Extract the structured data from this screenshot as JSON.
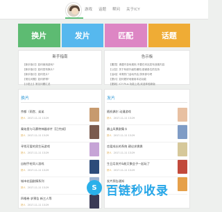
{
  "nav": {
    "items": [
      "游戏",
      "话题",
      "帮问",
      "关于ICY"
    ]
  },
  "tiles": [
    {
      "label": "换片",
      "color": "#5dbb72"
    },
    {
      "label": "发片",
      "color": "#56b8ee"
    },
    {
      "label": "匹配",
      "color": "#dd86c4"
    },
    {
      "label": "话题",
      "color": "#efac35"
    }
  ],
  "guide": {
    "title": "新手指南",
    "items": [
      "【新手指引】如何使用游戏?",
      "【新手指引】如何发布换片?",
      "【新手指引】如何发片?",
      "【常见问题】如何获得?",
      "【小贴士】常见问题汇总"
    ]
  },
  "notice": {
    "title": "告示板",
    "items": [
      "【置顶】请遵守游戏规则,不要在本站发布违规内容",
      "【公告】关于系统升级的通知,感谢各位的支持",
      "【活动】本周热门活动开启,快来参与吧",
      "【提示】如何更好地使用本站功能",
      "【更新】ICY Plus 功能上线,欢迎体验新版"
    ]
  },
  "left_section": {
    "title": "换片"
  },
  "right_section": {
    "title": "发片"
  },
  "left_items": [
    {
      "title": "京都（雨宫、弟弟",
      "tag": "好人",
      "meta": "2017-11-11 13:29"
    },
    {
      "title": "秦始皇与马赛特神器求片【已完成】",
      "tag": "好人",
      "meta": "2017-11-11 13:29"
    },
    {
      "title": "寻找可爱的男生玩游戏",
      "tag": "好人",
      "meta": "2017-11-11 13:29"
    },
    {
      "title": "自制手绘同人游戏",
      "tag": "好人",
      "meta": "2017-11-11 13:29"
    },
    {
      "title": "城市花园剧情系列",
      "tag": "好人",
      "meta": "2017-11-11 13:29"
    },
    {
      "title": "四格卷 求预告 新三人等",
      "tag": "好人",
      "meta": "2017-11-11 13:29"
    }
  ],
  "right_items": [
    {
      "title": "随机偶尔 动漫游戏",
      "tag": "好人",
      "meta": "2017-11-11 13:29"
    },
    {
      "title": "最山风景剧集卡",
      "tag": "好人",
      "meta": "2017-11-11 13:29"
    },
    {
      "title": "恋爱成长的系统 建议求换换",
      "tag": "好人",
      "meta": "2017-11-11 13:29"
    },
    {
      "title": "生日月发片&能又聚会子一起玩了",
      "tag": "好人",
      "meta": "2017-11-11 13:29"
    },
    {
      "title": "发片预告通知",
      "tag": "好人",
      "meta": "2017-11-11 13:29"
    }
  ],
  "left_thumbs": [
    "#c79a6e",
    "#7b5b4e",
    "#c6a4d6",
    "#2d4c7a",
    "#9bb4d4",
    "#3a3a55"
  ],
  "right_thumbs": [
    "#e8c0a2",
    "#7f9cc6",
    "#d6c89a",
    "#c24a3c",
    "#e6a04a"
  ],
  "watermark": {
    "glyph": "S",
    "text": "百链秒收录"
  }
}
